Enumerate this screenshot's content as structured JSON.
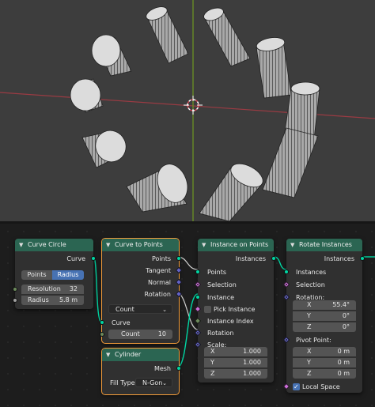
{
  "nodes": {
    "curve_circle": {
      "title": "Curve Circle",
      "output_curve": "Curve",
      "mode_points": "Points",
      "mode_radius": "Radius",
      "resolution_label": "Resolution",
      "resolution_value": "32",
      "radius_label": "Radius",
      "radius_value": "5.8 m"
    },
    "curve_to_points": {
      "title": "Curve to Points",
      "out_points": "Points",
      "out_tangent": "Tangent",
      "out_normal": "Normal",
      "out_rotation": "Rotation",
      "mode": "Count",
      "in_curve": "Curve",
      "count_label": "Count",
      "count_value": "10"
    },
    "cylinder": {
      "title": "Cylinder",
      "out_mesh": "Mesh",
      "fill_type_label": "Fill Type",
      "fill_type_value": "N-Gon"
    },
    "instance_on_points": {
      "title": "Instance on Points",
      "out_instances": "Instances",
      "in_points": "Points",
      "in_selection": "Selection",
      "in_instance": "Instance",
      "pick_instance": "Pick Instance",
      "in_instance_index": "Instance Index",
      "in_rotation": "Rotation",
      "in_scale": "Scale:",
      "scale_x_label": "X",
      "scale_x": "1.000",
      "scale_y_label": "Y",
      "scale_y": "1.000",
      "scale_z_label": "Z",
      "scale_z": "1.000"
    },
    "rotate_instances": {
      "title": "Rotate Instances",
      "out_instances": "Instances",
      "in_instances": "Instances",
      "in_selection": "Selection",
      "in_rotation": "Rotation:",
      "rot_x_label": "X",
      "rot_x": "55.4°",
      "rot_y_label": "Y",
      "rot_y": "0°",
      "rot_z_label": "Z",
      "rot_z": "0°",
      "pivot_label": "Pivot Point:",
      "piv_x_label": "X",
      "piv_x": "0 m",
      "piv_y_label": "Y",
      "piv_y": "0 m",
      "piv_z_label": "Z",
      "piv_z": "0 m",
      "local_space": "Local Space"
    }
  },
  "colors": {
    "geometry_socket": "#00d6a3",
    "vector_socket": "#6363c7",
    "float_socket": "#a1a1a1",
    "int_socket": "#6c8a5c",
    "bool_socket": "#cc6ed8",
    "geometry_header": "#2b6552",
    "x_axis": "#d24350",
    "y_axis": "#86b51f",
    "selection_outline": "#f29c3a"
  }
}
